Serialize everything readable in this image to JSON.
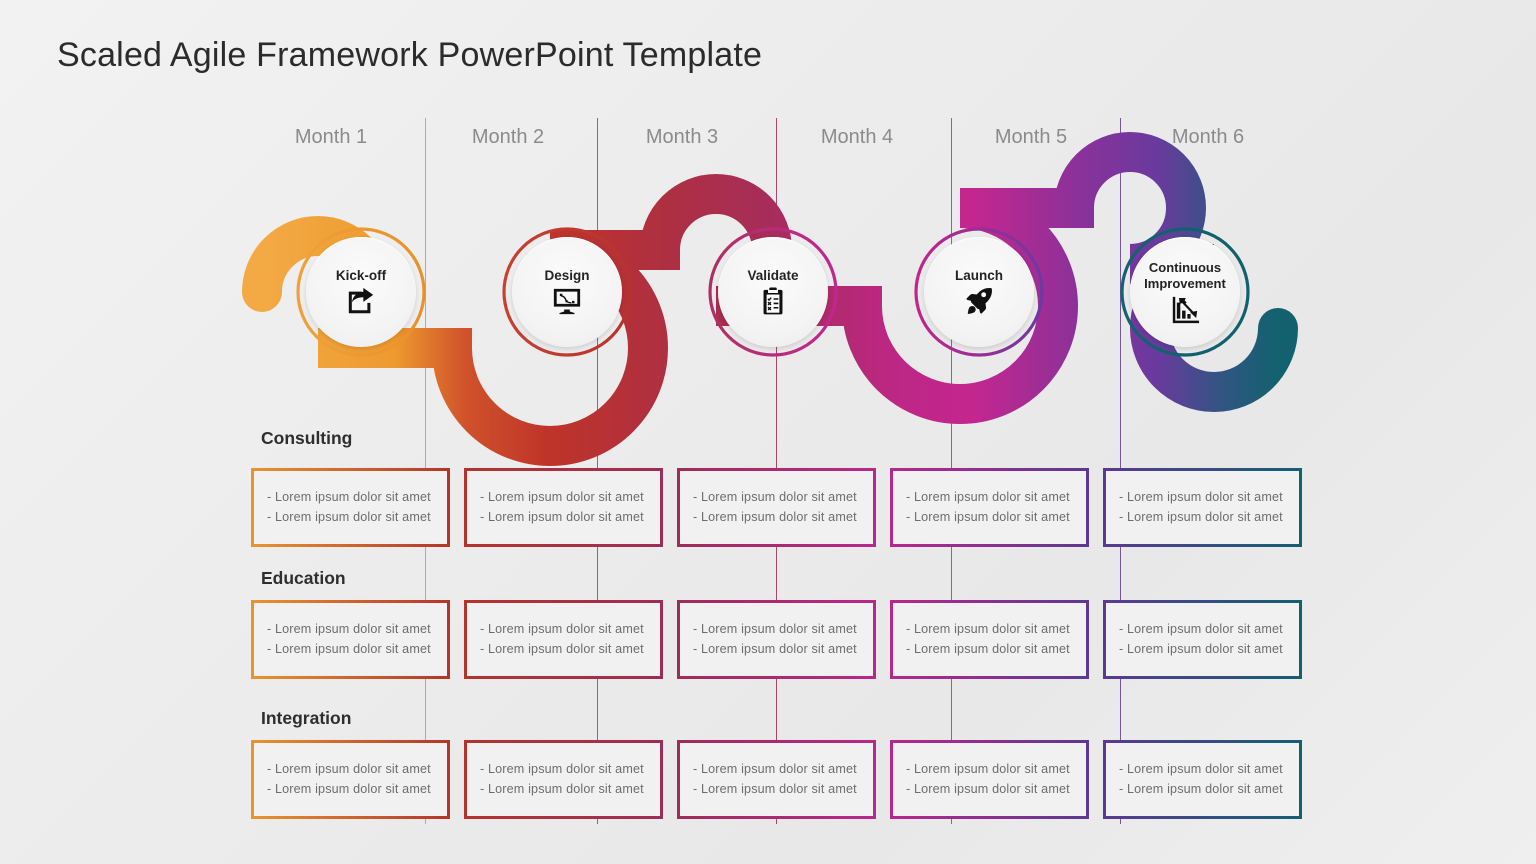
{
  "page": {
    "title": "Scaled Agile Framework PowerPoint Template",
    "background": "#eeeeee"
  },
  "timeline": {
    "months": [
      {
        "label": "Month 1"
      },
      {
        "label": "Month 2"
      },
      {
        "label": "Month 3"
      },
      {
        "label": "Month 4"
      },
      {
        "label": "Month 5"
      },
      {
        "label": "Month 6"
      }
    ],
    "nodes": [
      {
        "label": "Kick-off",
        "icon": "share-arrow-icon",
        "color_start": "#F0A03A",
        "color_end": "#E8912B"
      },
      {
        "label": "Design",
        "icon": "monitor-pen-tool-icon",
        "color_start": "#C9402F",
        "color_end": "#B6332F"
      },
      {
        "label": "Validate",
        "icon": "clipboard-checklist-icon",
        "color_start": "#B02F63",
        "color_end": "#C2268F"
      },
      {
        "label": "Launch",
        "icon": "rocket-icon",
        "color_start": "#C4238C",
        "color_end": "#6C3A9E"
      },
      {
        "label": "Continuous Improvement",
        "icon": "bar-chart-arrow-icon",
        "color_start": "#14616F",
        "color_end": "#10606E"
      }
    ],
    "ribbon_colors": {
      "orange": "#F0A03A",
      "red": "#C0382B",
      "crimson": "#A92D53",
      "magenta": "#C2268F",
      "purple": "#6C3A9E",
      "teal": "#156271"
    },
    "guide_colors": [
      "#E2923B",
      "#C0392B",
      "#A02C5B",
      "#BD2A8C",
      "#5F3A96"
    ]
  },
  "rows": [
    {
      "title": "Consulting",
      "cells": [
        {
          "lines": [
            "- Lorem ipsum  dolor  sit amet",
            "- Lorem ipsum  dolor  sit amet"
          ]
        },
        {
          "lines": [
            "- Lorem ipsum  dolor  sit amet",
            "- Lorem ipsum  dolor  sit amet"
          ]
        },
        {
          "lines": [
            "- Lorem ipsum  dolor  sit amet",
            "- Lorem ipsum  dolor  sit amet"
          ]
        },
        {
          "lines": [
            "- Lorem ipsum  dolor  sit amet",
            "- Lorem ipsum  dolor  sit amet"
          ]
        },
        {
          "lines": [
            "- Lorem ipsum  dolor  sit amet",
            "- Lorem ipsum  dolor  sit amet"
          ]
        }
      ]
    },
    {
      "title": "Education",
      "cells": [
        {
          "lines": [
            "- Lorem ipsum  dolor  sit amet",
            "- Lorem ipsum  dolor  sit amet"
          ]
        },
        {
          "lines": [
            "- Lorem ipsum  dolor  sit amet",
            "- Lorem ipsum  dolor  sit amet"
          ]
        },
        {
          "lines": [
            "- Lorem ipsum  dolor  sit amet",
            "- Lorem ipsum  dolor  sit amet"
          ]
        },
        {
          "lines": [
            "- Lorem ipsum  dolor  sit amet",
            "- Lorem ipsum  dolor  sit amet"
          ]
        },
        {
          "lines": [
            "- Lorem ipsum  dolor  sit amet",
            "- Lorem ipsum  dolor  sit amet"
          ]
        }
      ]
    },
    {
      "title": "Integration",
      "cells": [
        {
          "lines": [
            "- Lorem ipsum  dolor  sit amet",
            "- Lorem ipsum  dolor  sit amet"
          ]
        },
        {
          "lines": [
            "- Lorem ipsum  dolor  sit amet",
            "- Lorem ipsum  dolor  sit amet"
          ]
        },
        {
          "lines": [
            "- Lorem ipsum  dolor  sit amet",
            "- Lorem ipsum  dolor  sit amet"
          ]
        },
        {
          "lines": [
            "- Lorem ipsum  dolor  sit amet",
            "- Lorem ipsum  dolor  sit amet"
          ]
        },
        {
          "lines": [
            "- Lorem ipsum  dolor  sit amet",
            "- Lorem ipsum  dolor  sit amet"
          ]
        }
      ]
    }
  ],
  "box_border_gradients": [
    {
      "from": "#E8952E",
      "to": "#B3342C"
    },
    {
      "from": "#B3342C",
      "to": "#9E2C59"
    },
    {
      "from": "#9E2C59",
      "to": "#B8278A"
    },
    {
      "from": "#B8278A",
      "to": "#5C3893"
    },
    {
      "from": "#5C3893",
      "to": "#126170"
    }
  ]
}
